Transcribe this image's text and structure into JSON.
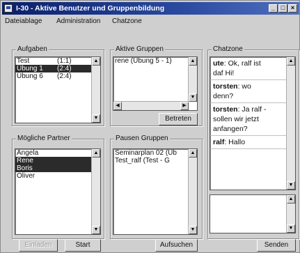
{
  "window": {
    "title": "I-30 - Aktive Benutzer und Gruppenbildung"
  },
  "titlebar_buttons": [
    "_",
    "□",
    "×"
  ],
  "menu": {
    "items": [
      "Dateiablage",
      "Administration",
      "Chatzone"
    ]
  },
  "aufgaben": {
    "title": "Aufgaben",
    "items": [
      {
        "name": "Test",
        "info": "(1:1)",
        "selected": false
      },
      {
        "name": "Übung 1",
        "info": "(2:4)",
        "selected": true
      },
      {
        "name": "Übung 6",
        "info": "(2:4)",
        "selected": false
      }
    ]
  },
  "aktive_gruppen": {
    "title": "Aktive Gruppen",
    "items": [
      "rene (Übung 5 - 1)"
    ],
    "button": "Betreten"
  },
  "moegliche_partner": {
    "title": "Mögliche Partner",
    "items": [
      {
        "name": "Angela",
        "selected": false
      },
      {
        "name": "Rene",
        "selected": true
      },
      {
        "name": "Boris",
        "selected": true
      },
      {
        "name": "Oliver",
        "selected": false
      }
    ],
    "button_disabled": "Einladen",
    "button": "Start"
  },
  "pausen_gruppen": {
    "title": "Pausen Gruppen",
    "items": [
      "Seminarplan 02 (Üb",
      "Test_ralf (Test - G"
    ],
    "button": "Aufsuchen"
  },
  "chat": {
    "title": "Chatzone",
    "messages": [
      {
        "user": "ute",
        "text": ": Ok, ralf ist\ndaf Hi!"
      },
      {
        "user": "torsten",
        "text": ": wo\ndenn?"
      },
      {
        "user": "torsten",
        "text": ": Ja ralf -\nsollen wir jetzt\nanfangen?"
      },
      {
        "user": "ralf",
        "text": ": Hallo"
      }
    ],
    "send_button": "Senden"
  }
}
